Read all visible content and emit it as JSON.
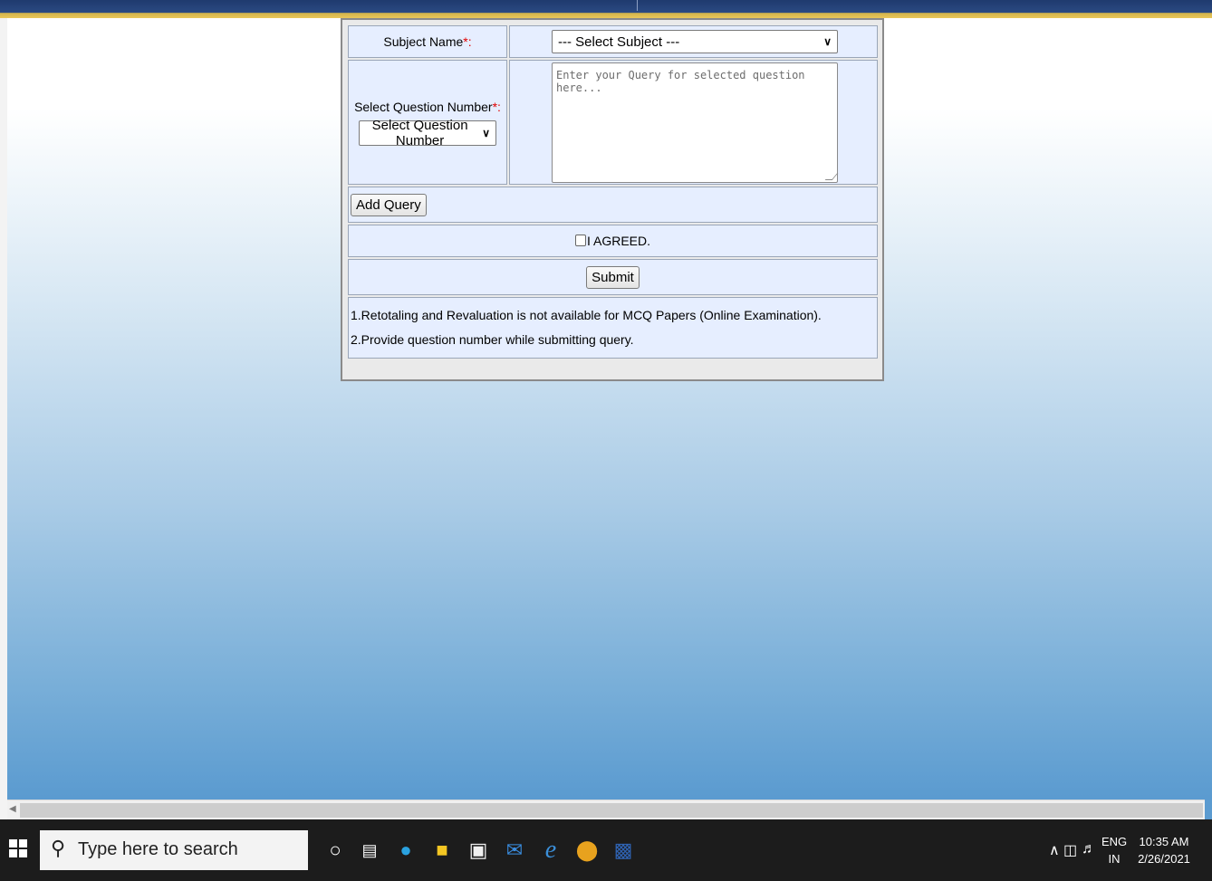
{
  "form": {
    "subject_label": "Subject Name",
    "required_mark": "*:",
    "subject_select": "--- Select Subject ---",
    "question_label": "Select Question Number",
    "question_select": "Select Question Number",
    "query_placeholder": "Enter your Query for selected question here...",
    "add_query_button": "Add Query",
    "agree_label": "I AGREED.",
    "submit_button": "Submit",
    "notes": [
      "1.Retotaling and Revaluation is not available for MCQ Papers (Online Examination).",
      "2.Provide question number while submitting query."
    ]
  },
  "taskbar": {
    "search_placeholder": "Type here to search",
    "lang_line1": "ENG",
    "lang_line2": "IN",
    "time": "10:35 AM",
    "date": "2/26/2021",
    "icons": [
      "windows-start-icon",
      "search-icon",
      "cortana-icon",
      "task-view-icon",
      "edge-icon",
      "file-explorer-icon",
      "store-icon",
      "mail-icon",
      "internet-explorer-icon",
      "chrome-icon",
      "word-icon"
    ]
  },
  "colors": {
    "notes_red": "#e8101a",
    "cell_bg": "#e6eeff",
    "header_navy": "#1f3a6e",
    "header_gold": "#e9c75a"
  }
}
